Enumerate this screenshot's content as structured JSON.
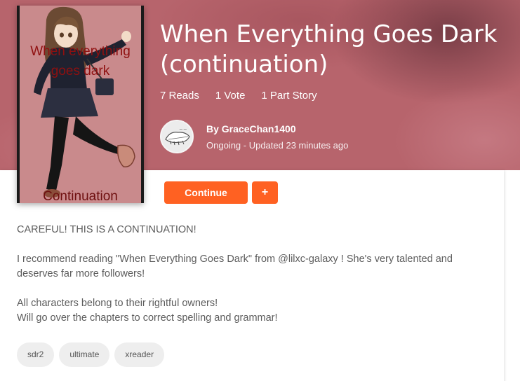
{
  "cover": {
    "title_text": "When everything goes dark",
    "subtitle_text": "Continuation"
  },
  "story": {
    "title": "When Everything Goes Dark (continuation)",
    "reads": "7 Reads",
    "votes": "1 Vote",
    "parts": "1 Part Story"
  },
  "author": {
    "name": "By GraceChan1400",
    "status": "Ongoing - Updated 23 minutes ago"
  },
  "actions": {
    "continue_label": "Continue",
    "add_label": "+"
  },
  "description": {
    "line1": "CAREFUL! THIS IS A CONTINUATION!",
    "line2": "I recommend reading \"When Everything Goes Dark\" from @lilxc-galaxy ! She's very talented and deserves far more followers!",
    "line3a": "All characters belong to their rightful owners!",
    "line3b": "Will go over the chapters to correct spelling and grammar!"
  },
  "tags": [
    "sdr2",
    "ultimate",
    "xreader"
  ],
  "colors": {
    "header_bg": "#b7646c",
    "accent": "#ff6122",
    "cover_bg": "#c98a8c",
    "cover_text": "#8f1010"
  },
  "icons": {
    "avatar": "author-avatar-image",
    "cover": "book-cover-art"
  }
}
